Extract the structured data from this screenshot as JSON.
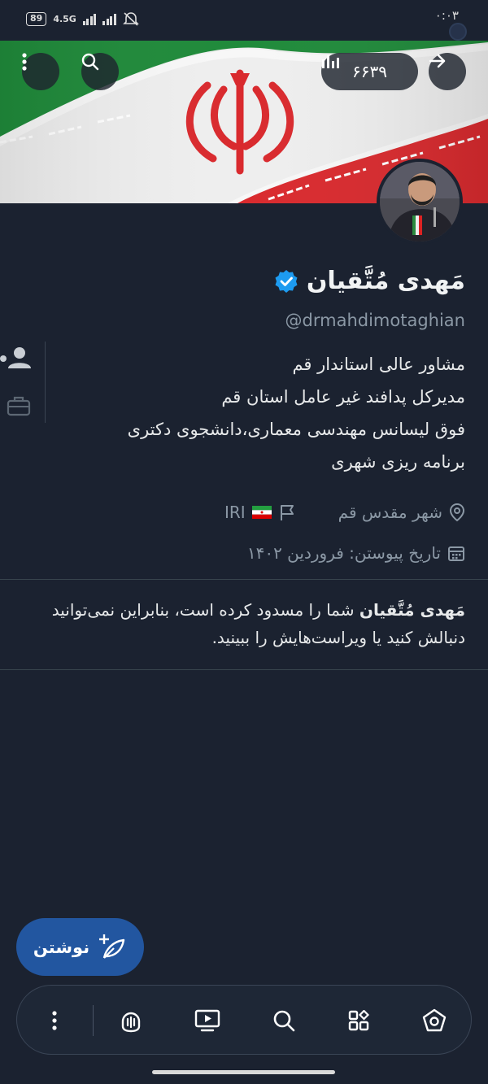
{
  "status_bar": {
    "battery": "89",
    "network": "4.5G",
    "time": "۰:۰۳"
  },
  "header": {
    "view_count": "۶۶۳۹"
  },
  "profile": {
    "name": "مَهدی مُتَّقیان",
    "handle": "@drmahdimotaghian",
    "bio": [
      "مشاور عالی استاندار قم",
      " مدیرکل پدافند غیر عامل استان قم",
      "فوق لیسانس مهندسی معماری،دانشجوی دکتری",
      "برنامه ریزی شهری"
    ],
    "location": "شهر مقدس قم",
    "flag_text": "IRI",
    "joined": "تاریخ پیوستن: فروردین ۱۴۰۲"
  },
  "blocked_notice": {
    "name": "مَهدی مُتَّقیان",
    "text": " شما را مسدود کرده است، بنابراین نمی‌توانید دنبالش کنید یا ویراست‌هایش را ببینید."
  },
  "fab": {
    "label": "نوشتن"
  },
  "nav": {
    "items": [
      "more-icon",
      "spaces-icon",
      "video-icon",
      "search-icon",
      "grok-icon",
      "home-icon"
    ]
  },
  "colors": {
    "background": "#1b2230",
    "accent": "#2256a0",
    "muted": "#8b98a5",
    "verified": "#1d9bf0"
  }
}
